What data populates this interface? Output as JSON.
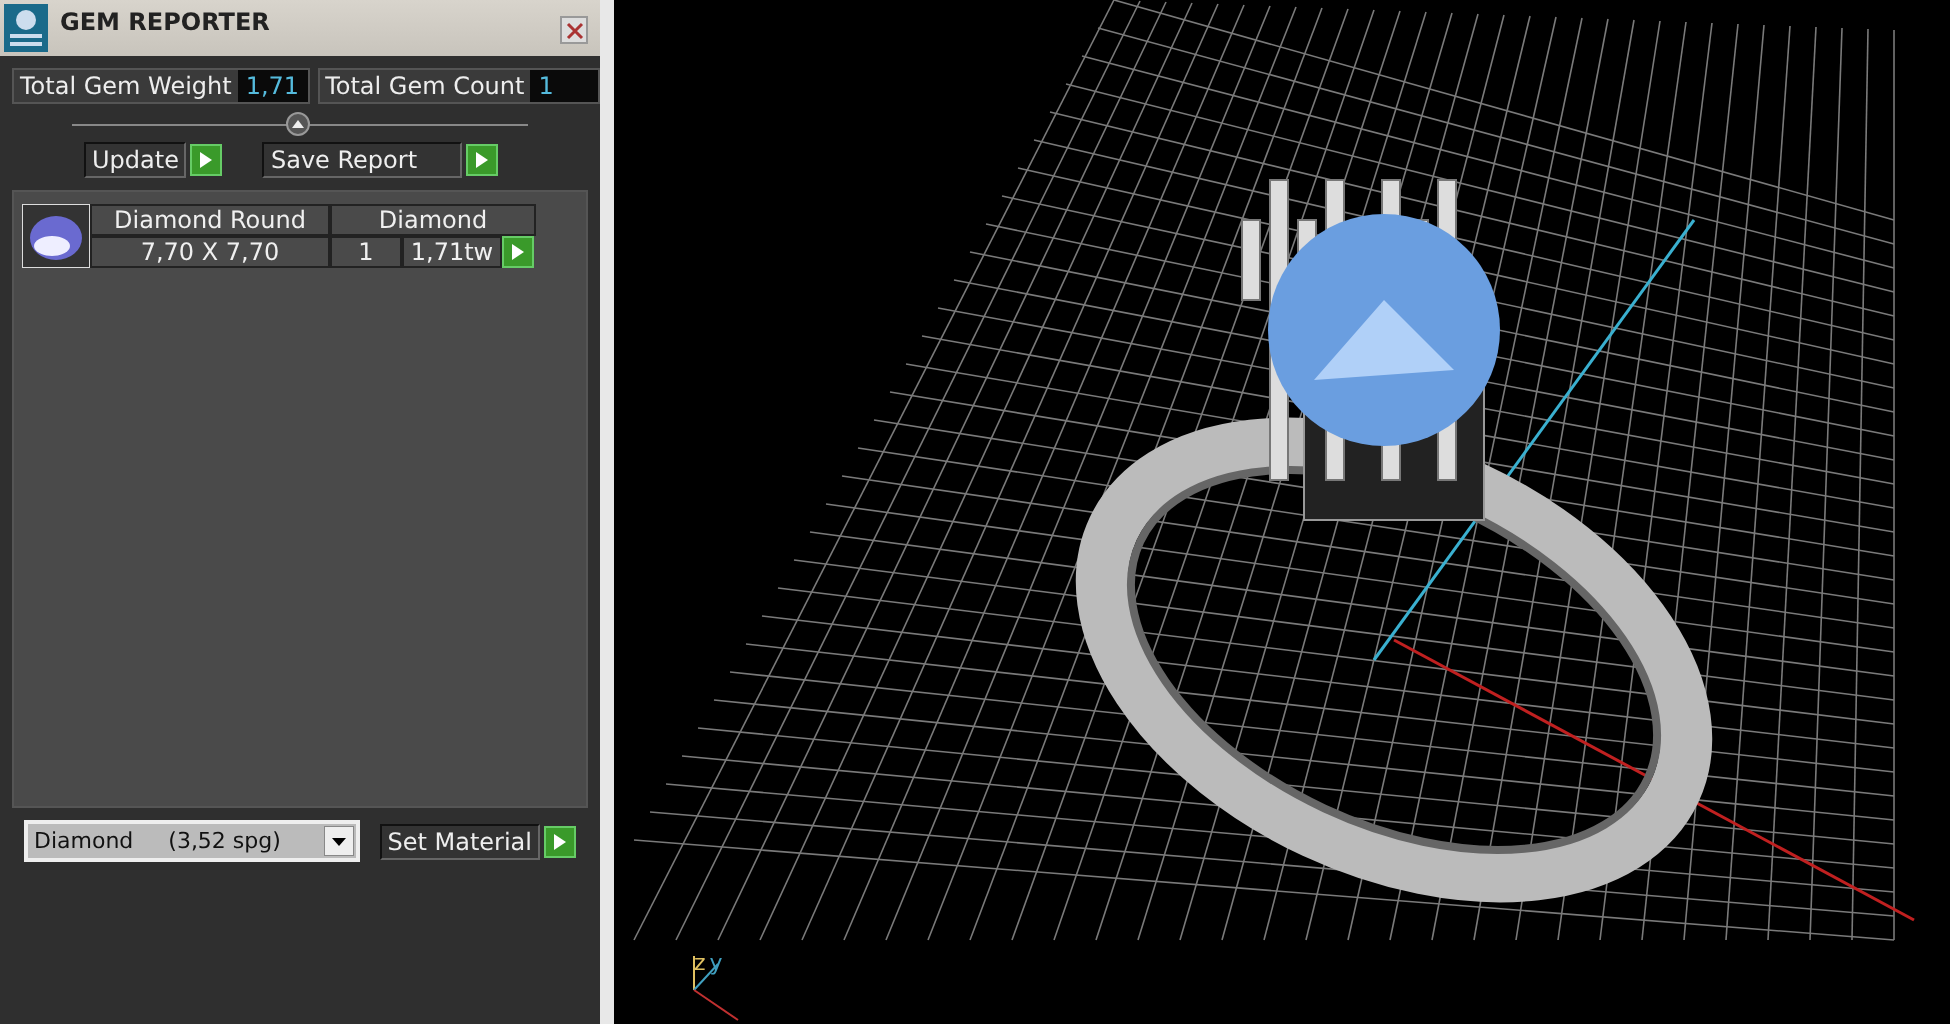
{
  "panel": {
    "title": "GEM REPORTER",
    "stats": [
      {
        "label": "Total Gem Weight",
        "value": "1,71"
      },
      {
        "label": "Total Gem Count",
        "value": "1"
      }
    ],
    "actions": [
      {
        "label": "Update"
      },
      {
        "label": "Save Report"
      }
    ],
    "gems": [
      {
        "shape": "Diamond Round",
        "size": "7,70 X 7,70",
        "material": "Diamond",
        "count": "1",
        "weight": "1,71tw"
      }
    ],
    "material_select": {
      "value": "Diamond     (3,52 spg)"
    },
    "set_button": {
      "label": "Set Material"
    }
  },
  "viewport": {
    "axes": [
      {
        "label": "z",
        "color": "#e0c060"
      },
      {
        "label": "y",
        "color": "#40a0c0"
      }
    ]
  }
}
